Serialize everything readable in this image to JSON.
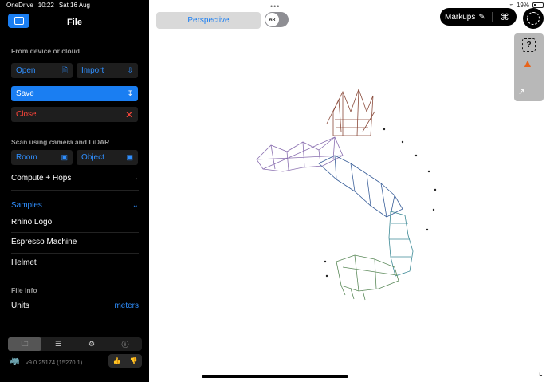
{
  "status": {
    "carrier": "OneDrive",
    "time": "10:22",
    "date": "Sat 16 Aug",
    "battery": "19%"
  },
  "sidebar": {
    "title": "File",
    "from_device_label": "From device or cloud",
    "open_label": "Open",
    "import_label": "Import",
    "save_label": "Save",
    "close_label": "Close",
    "scan_label": "Scan using camera and LiDAR",
    "room_label": "Room",
    "object_label": "Object",
    "compute_label": "Compute + Hops",
    "samples_label": "Samples",
    "samples": [
      "Rhino Logo",
      "Espresso Machine",
      "Helmet"
    ],
    "file_info_label": "File info",
    "units_label": "Units",
    "units_value": "meters",
    "version": "v9.0.25174 (15270.1)"
  },
  "viewport": {
    "view_name": "Perspective",
    "ar_label": "AR",
    "markups_label": "Markups"
  },
  "icons": [
    "sidebar-toggle-icon",
    "document-icon",
    "import-icon",
    "save-icon",
    "close-icon",
    "scan-room-icon",
    "scan-object-icon",
    "arrow-right-icon",
    "chevron-down-icon",
    "folder-icon",
    "layers-icon",
    "gear-icon",
    "help-icon",
    "rhino-icon",
    "thumbs-up-icon",
    "thumbs-down-icon",
    "markup-icon",
    "command-icon",
    "cursor-icon",
    "help-box-icon",
    "fire-icon",
    "expand-icon"
  ],
  "colors": {
    "accent": "#1a7ef2",
    "close_red": "#ff453a",
    "sidebar_bg": "#000000"
  }
}
